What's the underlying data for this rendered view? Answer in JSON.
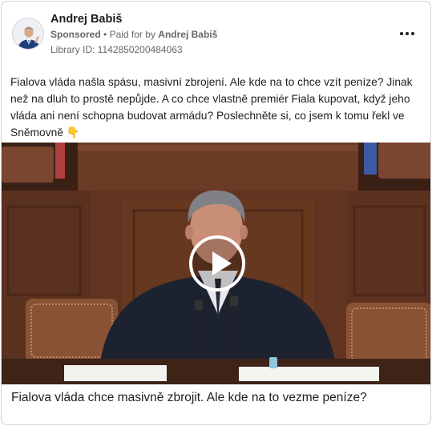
{
  "ad": {
    "advertiser_name": "Andrej Babiš",
    "sponsored_label": "Sponsored",
    "separator": "•",
    "paid_for_label": "Paid for by",
    "paid_for_name": "Andrej Babiš",
    "library_id": "Library ID: 1142850200484063",
    "more_icon": "more-horizontal-icon",
    "body_text": "Fialova vláda našla spásu, masivní zbrojení. Ale kde na to chce vzít peníze? Jinak než na dluh to prostě nepůjde. A co chce vlastně premiér Fiala kupovat, když jeho vláda ani není schopna budovat armádu? Poslechněte si, co jsem k tomu řekl ve Sněmovně 👇",
    "video_caption": "Fialova vláda chce masivně zbrojit. Ale kde na to vezme peníze?",
    "play_icon": "play-icon"
  },
  "colors": {
    "text": "#1c1e21",
    "secondary_text": "#65676b",
    "border": "#cfd3d8",
    "wood": "#6b3a22"
  }
}
